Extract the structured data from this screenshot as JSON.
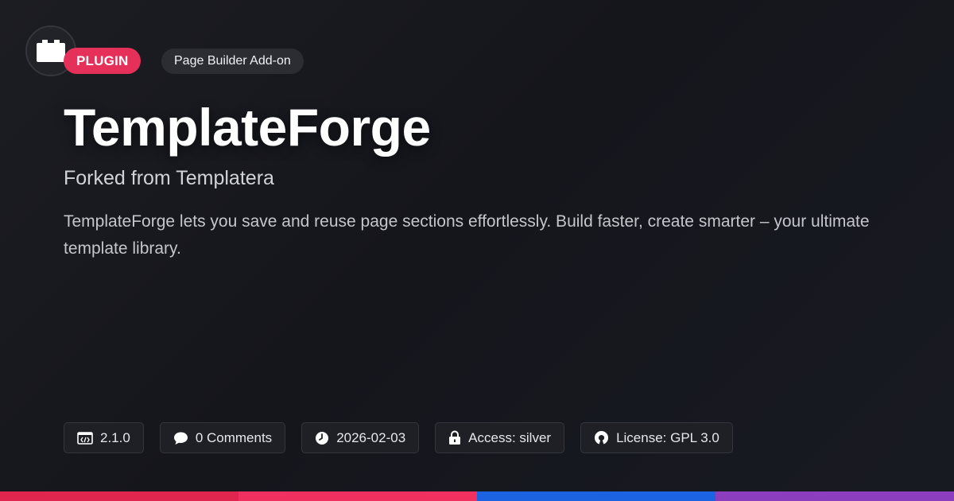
{
  "badges": {
    "type_label": "PLUGIN",
    "category_label": "Page Builder Add-on"
  },
  "logo": {
    "icon": "puzzle-brick-icon"
  },
  "title": "TemplateForge",
  "subtitle": "Forked from Templatera",
  "description": "TemplateForge lets you save and reuse page sections effortlessly. Build faster, create smarter – your ultimate template library.",
  "meta": {
    "version": "2.1.0",
    "comments": "0 Comments",
    "date": "2026-02-03",
    "access": "Access: silver",
    "license": "License: GPL 3.0"
  },
  "icons": [
    "code-icon",
    "comment-icon",
    "clock-icon",
    "lock-icon",
    "open-source-icon"
  ],
  "colors": {
    "accent": "#e5315a",
    "bar_segments": [
      "#e0264f",
      "#f0305e",
      "#1b63e0",
      "#8b3fbf"
    ]
  }
}
